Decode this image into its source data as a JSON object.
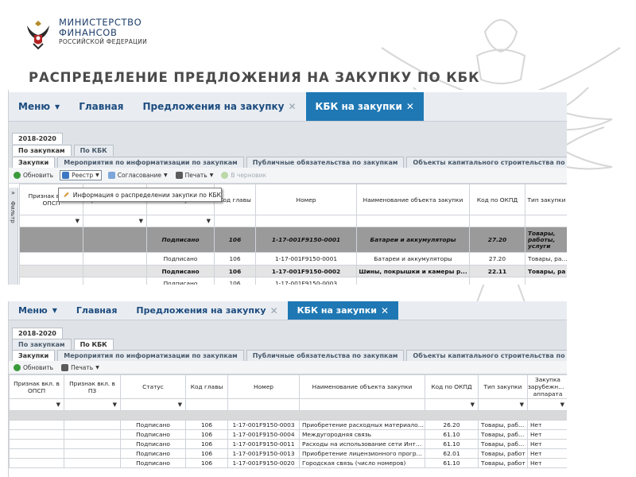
{
  "logo": {
    "line1": "МИНИСТЕРСТВО",
    "line2": "ФИНАНСОВ",
    "line3": "РОССИЙСКОЙ ФЕДЕРАЦИИ"
  },
  "slide_title": "РАСПРЕДЕЛЕНИЕ  ПРЕДЛОЖЕНИЯ НА ЗАКУПКУ ПО КБК",
  "shot1": {
    "nav": {
      "menu": "Меню",
      "home": "Главная",
      "proposals": "Предложения на закупку",
      "kbk": "КБК на закупки"
    },
    "year_tab": "2018-2020",
    "view_tabs": [
      "По закупкам",
      "По КБК"
    ],
    "section_tabs": [
      "Закупки",
      "Мероприятия по информатизации по закупкам",
      "Публичные обязательства по закупкам",
      "Объекты капитального строительства по закупкам"
    ],
    "toolbar": {
      "refresh": "Обновить",
      "registry": "Реестр",
      "approval": "Согласование",
      "print": "Печать",
      "draft": "В черновик"
    },
    "popup_item": "Информация о распределении закупки по КБК",
    "filter_label": "Фильтр",
    "columns": [
      "Признак вкл. в ОПСП",
      "Признак вкл. в ПЗ",
      "Статус",
      "Код главы",
      "Номер",
      "Наименование объекта закупки",
      "Код по ОКПД",
      "Тип закупки"
    ],
    "rows": [
      {
        "status": "Подписано",
        "code": "106",
        "number": "1-17-001F9150-0001",
        "name": "Батареи и аккумуляторы",
        "okpd": "27.20",
        "type": "Товары, работы, услуги"
      },
      {
        "status": "Подписано",
        "code": "106",
        "number": "1-17-001F9150-0001",
        "name": "Батареи и аккумуляторы",
        "okpd": "27.20",
        "type": "Товары, работы"
      },
      {
        "status": "Подписано",
        "code": "106",
        "number": "1-17-001F9150-0002",
        "name": "Шины, покрышки и камеры р...",
        "okpd": "22.11",
        "type": "Товары, ра"
      },
      {
        "status": "Подписано",
        "code": "106",
        "number": "1-17-001F9150-0003",
        "name": "",
        "okpd": "",
        "type": ""
      }
    ]
  },
  "shot2": {
    "nav": {
      "menu": "Меню",
      "home": "Главная",
      "proposals": "Предложения на закупку",
      "kbk": "КБК на закупки"
    },
    "year_tab": "2018-2020",
    "view_tabs": [
      "По закупкам",
      "По КБК"
    ],
    "section_tabs": [
      "Закупки",
      "Мероприятия по информатизации по закупкам",
      "Публичные обязательства по закупкам",
      "Объекты капитального строительства по закупкам"
    ],
    "toolbar": {
      "refresh": "Обновить",
      "print": "Печать"
    },
    "columns": [
      "Признак вкл. в ОПСП",
      "Признак вкл. в ПЗ",
      "Статус",
      "Код главы",
      "Номер",
      "Наименование объекта закупки",
      "Код по ОКПД",
      "Тип закупки",
      "Закупка зарубежного аппарата"
    ],
    "rows": [
      {
        "status": "Подписано",
        "code": "106",
        "number": "1-17-001F9150-0003",
        "name": "Приобретение расходных материалов для о...",
        "okpd": "26.20",
        "type": "Товары, работ...",
        "foreign": "Нет"
      },
      {
        "status": "Подписано",
        "code": "106",
        "number": "1-17-001F9150-0004",
        "name": "Междугородняя связь",
        "okpd": "61.10",
        "type": "Товары, работ...",
        "foreign": "Нет"
      },
      {
        "status": "Подписано",
        "code": "106",
        "number": "1-17-001F9150-0011",
        "name": "Расходы на использование сети Интернет",
        "okpd": "61.10",
        "type": "Товары, работ...",
        "foreign": "Нет"
      },
      {
        "status": "Подписано",
        "code": "106",
        "number": "1-17-001F9150-0013",
        "name": "Приобретение лицензионного программного...",
        "okpd": "62.01",
        "type": "Товары, работ",
        "foreign": "Нет"
      },
      {
        "status": "Подписано",
        "code": "106",
        "number": "1-17-001F9150-0020",
        "name": "Городская связь (число номеров)",
        "okpd": "61.10",
        "type": "Товары, работ",
        "foreign": "Нет"
      }
    ]
  },
  "colors": {
    "accent_tab": "#1f78b4",
    "nav_text": "#1d4c7f",
    "title_gray": "#4a4a4a"
  }
}
